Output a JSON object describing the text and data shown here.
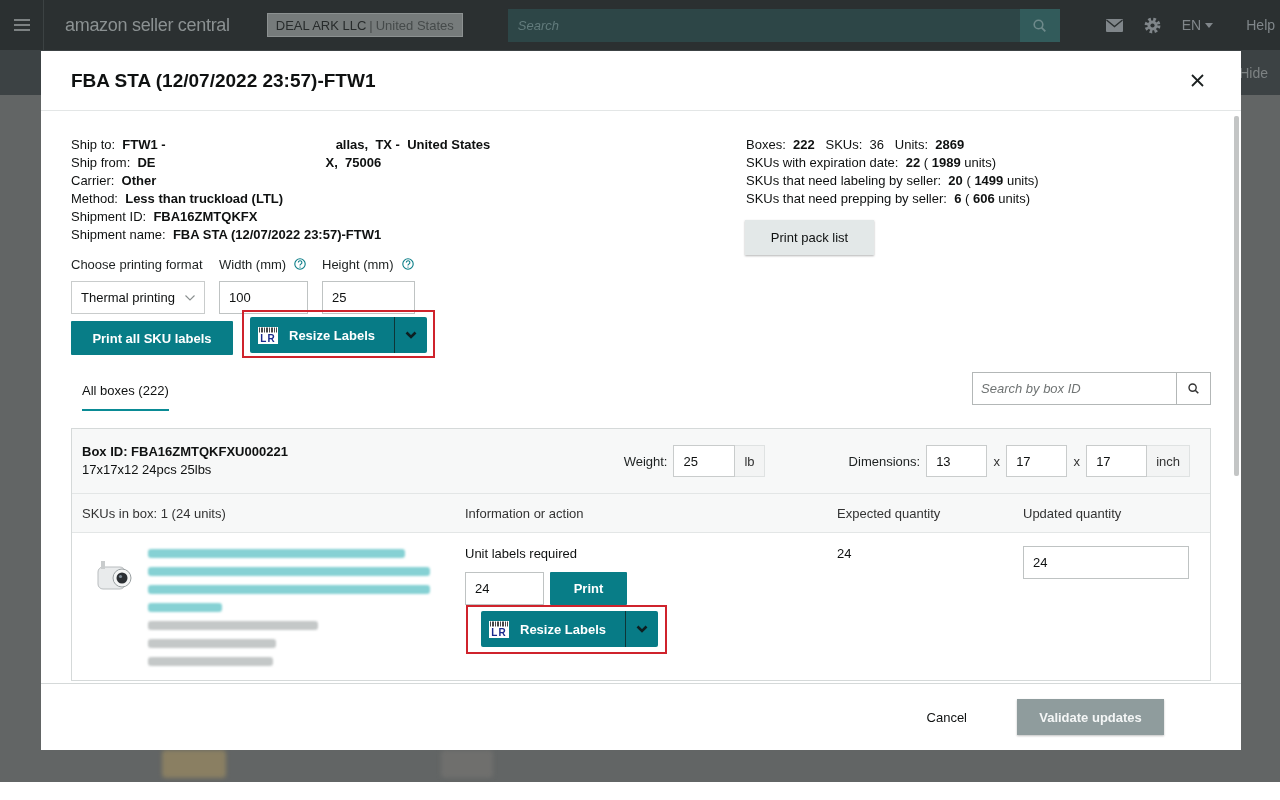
{
  "top_bar": {
    "brand": "amazon seller central",
    "account": "DEAL ARK LLC",
    "separator": "|",
    "marketplace": "United States",
    "search": {
      "placeholder": "Search"
    },
    "language": "EN",
    "help": "Help"
  },
  "sub_bar": {
    "hide_link": "Hide"
  },
  "modal": {
    "title": "FBA STA (12/07/2022 23:57)-FTW1",
    "shipment_details": [
      {
        "text": "Ship to:  **FTW1 -**",
        "continuation": "allas,  TX -  United States"
      },
      {
        "text": "Ship from:  **DE**",
        "continuation": "X,  75006"
      },
      {
        "text": "Carrier:  **Other**"
      },
      {
        "text": "Method:  **Less than truckload (LTL)**"
      },
      {
        "text": "Shipment ID:  **FBA16ZMTQKFX**"
      },
      {
        "text": "Shipment name:  **FBA STA (12/07/2022 23:57)-FTW1**"
      }
    ],
    "summary": [
      "Boxes:  **222**   SKUs:  36   Units:  **2869**",
      "SKUs with expiration date:  **22** ( **1989** units)",
      "SKUs that need labeling by seller:  **20** ( **1499** units)",
      "SKUs that need prepping by seller:  **6** ( **606** units)"
    ],
    "print_pack_list": "Print pack list",
    "printing": {
      "format_label": "Choose printing format",
      "format_value": "Thermal printing",
      "width_label": "Width (mm)",
      "width_value": "100",
      "height_label": "Height (mm)",
      "height_value": "25",
      "print_all": "Print all SKU labels",
      "resize": {
        "icon_text": "LR",
        "label": "Resize Labels",
        "highlighted": true
      }
    },
    "tabs": [
      {
        "label": "All boxes (222)",
        "selected": true
      }
    ],
    "box_search": {
      "placeholder": "Search by box ID"
    },
    "box": {
      "title": "Box ID: FBA16ZMTQKFXU000221",
      "description": "17x17x12 24pcs 25lbs",
      "weight": {
        "label": "Weight:",
        "value": "25",
        "unit": "lb"
      },
      "dimensions": {
        "label": "Dimensions:",
        "values": [
          "13",
          "17",
          "17"
        ],
        "separators": [
          "x",
          "x"
        ],
        "unit": "inch"
      },
      "columns": [
        "SKUs in box: 1 (24 units)",
        "Information or action",
        "Expected quantity",
        "Updated quantity"
      ],
      "items": [
        {
          "info": "Unit labels required",
          "label_quantity": "24",
          "print": "Print",
          "resize": {
            "icon_text": "LR",
            "label": "Resize Labels",
            "highlighted": true
          },
          "expected": "24",
          "updated": "24"
        }
      ]
    },
    "footer": {
      "cancel": "Cancel",
      "validate": {
        "label": "Validate updates",
        "disabled": true
      }
    }
  }
}
